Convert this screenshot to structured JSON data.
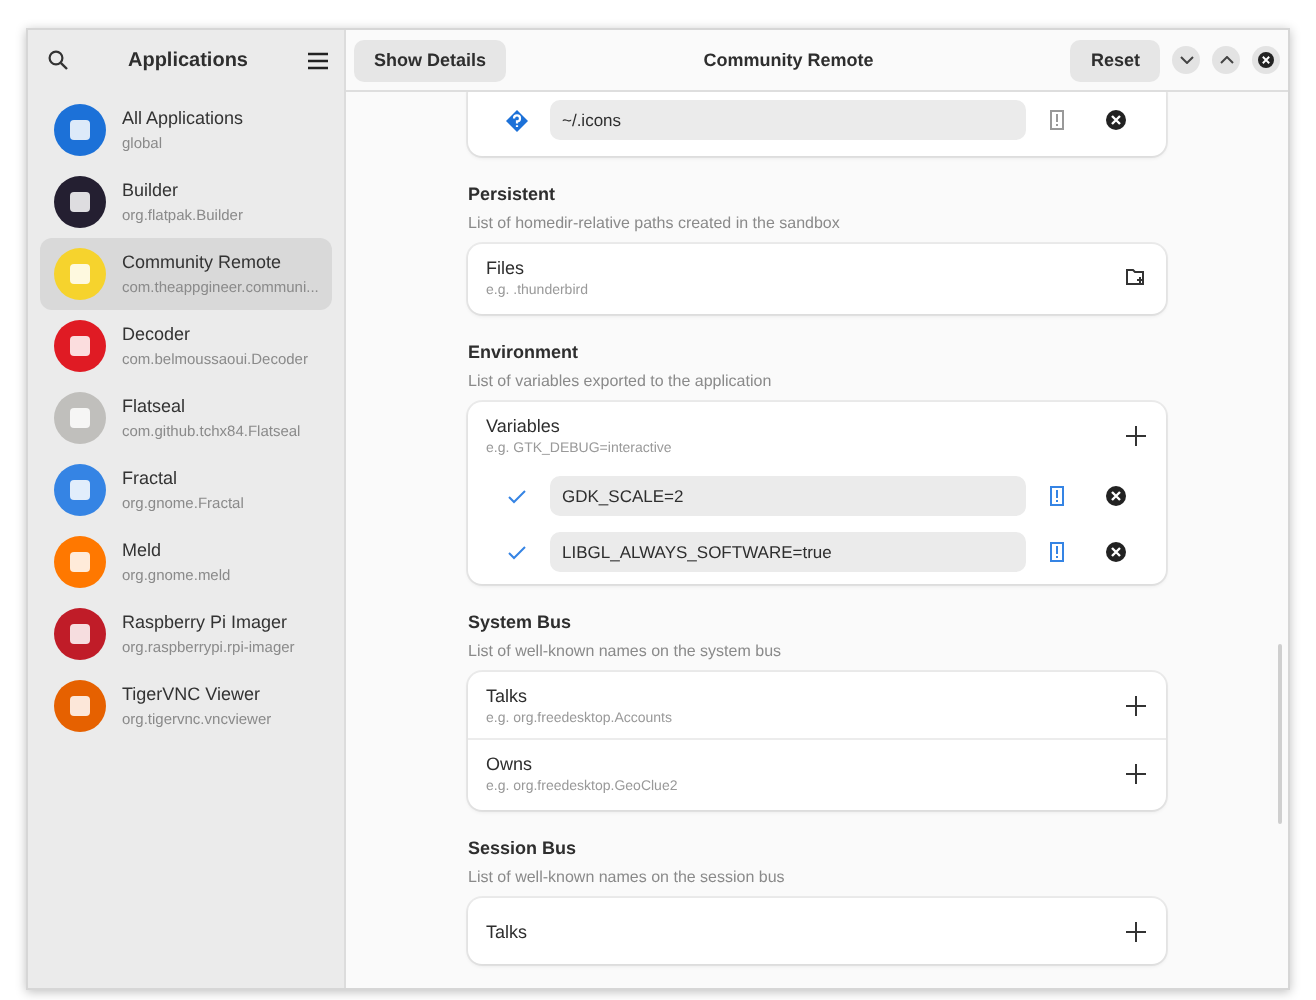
{
  "sidebar": {
    "title": "Applications",
    "items": [
      {
        "name": "All Applications",
        "id": "global",
        "selected": false,
        "color": "#1c71d8"
      },
      {
        "name": "Builder",
        "id": "org.flatpak.Builder",
        "selected": false,
        "color": "#241f31"
      },
      {
        "name": "Community Remote",
        "id": "com.theappgineer.communi...",
        "selected": true,
        "color": "#f6d32d"
      },
      {
        "name": "Decoder",
        "id": "com.belmoussaoui.Decoder",
        "selected": false,
        "color": "#e01b24"
      },
      {
        "name": "Flatseal",
        "id": "com.github.tchx84.Flatseal",
        "selected": false,
        "color": "#c0bfbc"
      },
      {
        "name": "Fractal",
        "id": "org.gnome.Fractal",
        "selected": false,
        "color": "#3584e4"
      },
      {
        "name": "Meld",
        "id": "org.gnome.meld",
        "selected": false,
        "color": "#ff7800"
      },
      {
        "name": "Raspberry Pi Imager",
        "id": "org.raspberrypi.rpi-imager",
        "selected": false,
        "color": "#c01c28"
      },
      {
        "name": "TigerVNC Viewer",
        "id": "org.tigervnc.vncviewer",
        "selected": false,
        "color": "#e66100"
      }
    ]
  },
  "header": {
    "left_button": "Show Details",
    "title": "Community Remote",
    "right_button": "Reset"
  },
  "top_card": {
    "rows": [
      {
        "kind": "unknown",
        "value": "~/.icons",
        "flagged": false
      }
    ]
  },
  "sections": [
    {
      "title": "Persistent",
      "description": "List of homedir-relative paths created in the sandbox",
      "rows": [
        {
          "kind": "folder",
          "label": "Files",
          "placeholder": "e.g. .thunderbird"
        }
      ]
    },
    {
      "title": "Environment",
      "description": "List of variables exported to the application",
      "rows": [
        {
          "kind": "entry",
          "label": "Variables",
          "placeholder": "e.g. GTK_DEBUG=interactive"
        },
        {
          "kind": "value",
          "value": "GDK_SCALE=2",
          "flagged": true
        },
        {
          "kind": "value",
          "value": "LIBGL_ALWAYS_SOFTWARE=true",
          "flagged": true
        }
      ]
    },
    {
      "title": "System Bus",
      "description": "List of well-known names on the system bus",
      "rows": [
        {
          "kind": "entry",
          "label": "Talks",
          "placeholder": "e.g. org.freedesktop.Accounts"
        },
        {
          "kind": "entry",
          "label": "Owns",
          "placeholder": "e.g. org.freedesktop.GeoClue2"
        }
      ]
    },
    {
      "title": "Session Bus",
      "description": "List of well-known names on the session bus",
      "rows": [
        {
          "kind": "entry",
          "label": "Talks"
        }
      ]
    }
  ]
}
